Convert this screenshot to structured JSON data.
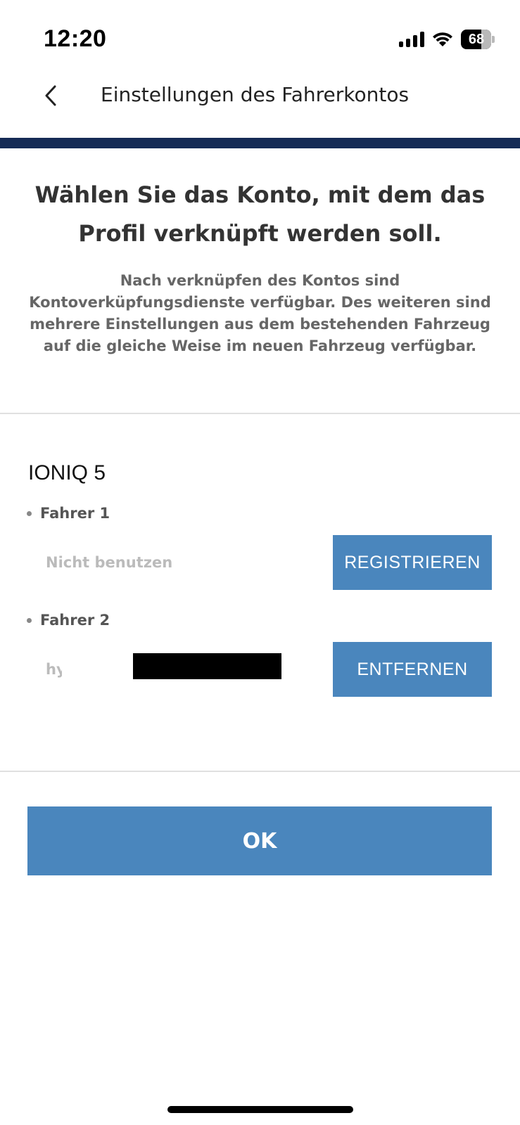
{
  "status_bar": {
    "time": "12:20",
    "battery": "68",
    "icons": [
      "signal-icon",
      "wifi-icon",
      "battery-icon"
    ]
  },
  "header": {
    "title": "Einstellungen des Fahrerkontos",
    "back_icon": "chevron-left-icon"
  },
  "intro": {
    "heading": "Wählen Sie das Konto, mit dem das Profil verknüpft werden soll.",
    "description": "Nach verknüpfen des Kontos sind Kontoverküpfungsdienste verfügbar. Des weiteren sind mehrere Einstellungen aus dem bestehenden Fahrzeug auf die gleiche Weise im neuen Fahrzeug verfügbar."
  },
  "vehicle": {
    "name": "IONIQ 5"
  },
  "drivers": [
    {
      "label": "Fahrer 1",
      "status": "Nicht benutzen",
      "button_label": "REGISTRIEREN"
    },
    {
      "label": "Fahrer 2",
      "status": "hy",
      "button_label": "ENTFERNEN"
    }
  ],
  "ok_button": {
    "label": "OK"
  },
  "colors": {
    "accent_button": "#4a86bd",
    "header_bar": "#152b55"
  }
}
